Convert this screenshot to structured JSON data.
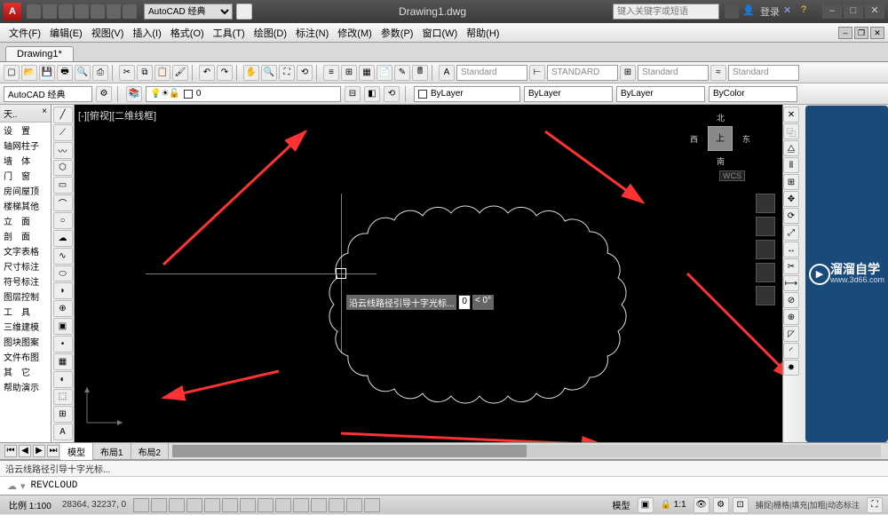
{
  "app": {
    "logo": "A",
    "title": "Drawing1.dwg",
    "workspace": "AutoCAD 经典",
    "search_ph": "键入关键字或短语",
    "login": "登录"
  },
  "menu": [
    "文件(F)",
    "编辑(E)",
    "视图(V)",
    "插入(I)",
    "格式(O)",
    "工具(T)",
    "绘图(D)",
    "标注(N)",
    "修改(M)",
    "参数(P)",
    "窗口(W)",
    "帮助(H)"
  ],
  "file_tab": "Drawing1*",
  "props": {
    "std1": "Standard",
    "std2": "STANDARD",
    "std3": "Standard",
    "std4": "Standard"
  },
  "layer": {
    "combo_ws": "AutoCAD 经典",
    "layer_name": "0",
    "bylayer": "ByLayer",
    "bycolor": "ByColor"
  },
  "panel_title": "天..",
  "panel_items": [
    "设　置",
    "轴网柱子",
    "墙　体",
    "门　窗",
    "房间屋顶",
    "楼梯其他",
    "立　面",
    "剖　面",
    "文字表格",
    "尺寸标注",
    "符号标注",
    "图层控制",
    "工　具",
    "三维建模",
    "图块图案",
    "文件布图",
    "其　它",
    "帮助演示"
  ],
  "view_label": "[-][俯视][二维线框]",
  "dynamic": {
    "prompt": "沿云线路径引导十字光标...",
    "len": "0",
    "ang": "< 0°"
  },
  "viewcube": {
    "top": "上",
    "n": "北",
    "s": "南",
    "e": "东",
    "w": "西",
    "wcs": "WCS"
  },
  "layouts": {
    "model": "模型",
    "l1": "布局1",
    "l2": "布局2"
  },
  "cmd_history": "沿云线路径引导十字光标...",
  "cmd_icon": "☁",
  "cmd_text": "REVCLOUD",
  "tip_brand": "溜溜自学",
  "tip_url": "www.3d66.com",
  "status": {
    "scale": "比例 1:100",
    "coords": "28364, 32237, 0",
    "mode": "模型",
    "anno": "1:1",
    "toggles": "捕捉|栅格|填充|加粗|动态标注"
  }
}
